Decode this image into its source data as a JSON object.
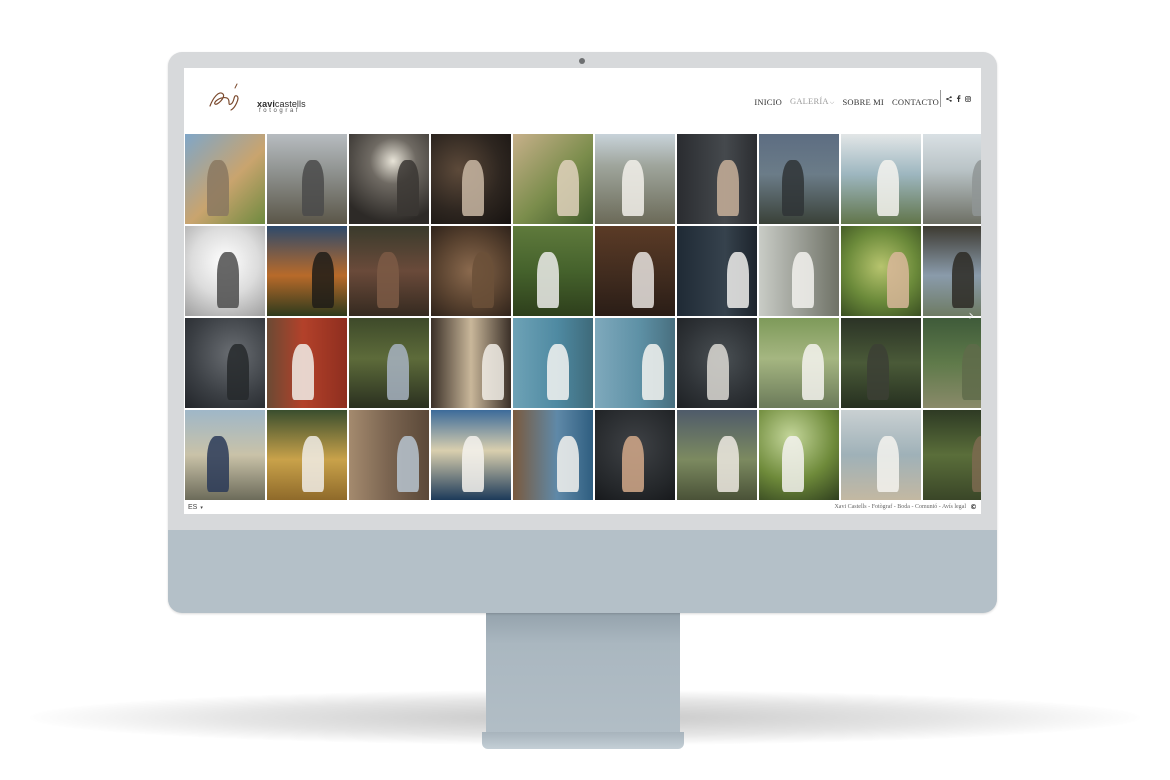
{
  "site": {
    "logo_word_bold": "xavi",
    "logo_word_light": "castells",
    "logo_sub": "fotograf"
  },
  "nav": {
    "items": [
      {
        "label": "INICIO"
      },
      {
        "label": "GALERÍA"
      },
      {
        "label": "SOBRE MI"
      },
      {
        "label": "CONTACTO"
      }
    ],
    "active": "GALERÍA"
  },
  "social_icons": [
    "share-icon",
    "facebook-icon",
    "instagram-icon"
  ],
  "gallery": {
    "rows": 4,
    "columns": 10,
    "next_arrow": "›",
    "tiles": [
      {
        "bg": "linear-gradient(135deg,#7fa6c8 0%,#c9a46e 55%,#6e8a3f 100%)",
        "fig": "#8a7860"
      },
      {
        "bg": "linear-gradient(180deg,#b7bcc0 0%,#8c8f8c 45%,#5b5648 100%)",
        "fig": "#4a4a4a"
      },
      {
        "bg": "radial-gradient(circle at 55% 30%,#e8e4d8 0%,#6f6a63 30%,#2d2a27 80%)",
        "fig": "#3a3632"
      },
      {
        "bg": "radial-gradient(circle at 35% 40%,#5d4a3a 0%,#2e2620 55%,#161210 100%)",
        "fig": "#c9b7a3"
      },
      {
        "bg": "linear-gradient(135deg,#c7b08a 0%,#7b8d4c 55%,#3f5a2a 100%)",
        "fig": "#e1d2bd"
      },
      {
        "bg": "linear-gradient(180deg,#c8d3da 0%,#9fa59c 35%,#6b6a58 100%)",
        "fig": "#f2f0ea"
      },
      {
        "bg": "linear-gradient(90deg,#2a2c30 0%,#45494d 60%,#2b2d31 100%)",
        "fig": "#c8b09a"
      },
      {
        "bg": "linear-gradient(180deg,#5d6d82 0%,#6b7c88 45%,#3a4138 100%)",
        "fig": "#2f3436"
      },
      {
        "bg": "linear-gradient(180deg,#e2e6e7 0%,#9db6bf 45%,#61754a 100%)",
        "fig": "#f4f3ee"
      },
      {
        "bg": "linear-gradient(180deg,#d9e0e4 0%,#b9c3c6 40%,#6d6f64 100%)",
        "fig": "#8f9595"
      },
      {
        "bg": "radial-gradient(circle at 50% 40%,#ffffff 0%,#dcdcdc 50%,#9e9e9e 100%)",
        "fig": "#4c4c4c"
      },
      {
        "bg": "linear-gradient(180deg,#2e4a6c 0%,#b86a2a 55%,#2e3a1c 100%)",
        "fig": "#1f1c18"
      },
      {
        "bg": "linear-gradient(180deg,#3a3b2c 0%,#6a4a3a 50%,#352a20 100%)",
        "fig": "#7c5a45"
      },
      {
        "bg": "radial-gradient(circle at 50% 50%,#8b6a4e 0%,#5a4330 55%,#2f231b 100%)",
        "fig": "#6b5038"
      },
      {
        "bg": "linear-gradient(180deg,#5f7a3c 0%,#45622c 50%,#2e3f1c 100%)",
        "fig": "#ececea"
      },
      {
        "bg": "linear-gradient(180deg,#5b3b26 0%,#3e2a1e 60%,#2a1d16 100%)",
        "fig": "#e7e3df"
      },
      {
        "bg": "linear-gradient(90deg,#1f2a35 0%,#36424d 60%,#1d242c 100%)",
        "fig": "#f0efec"
      },
      {
        "bg": "linear-gradient(90deg,#c9ccc6 0%,#9c9f97 50%,#6f7266 100%)",
        "fig": "#f3f2ee"
      },
      {
        "bg": "radial-gradient(circle at 50% 45%,#b7c46e 0%,#6b8a3a 55%,#3a4f22 100%)",
        "fig": "#d9b79a"
      },
      {
        "bg": "linear-gradient(180deg,#3d3a31 0%,#8a9bab 55%,#6e7b63 100%)",
        "fig": "#2d2a24"
      },
      {
        "bg": "radial-gradient(circle at 60% 40%,#6a6e73 0%,#3b3f44 60%,#22252a 100%)",
        "fig": "#26292c"
      },
      {
        "bg": "linear-gradient(90deg,#6b4a34 0%,#b3412a 45%,#8e2e1f 100%)",
        "fig": "#f1efe9"
      },
      {
        "bg": "linear-gradient(180deg,#3e4a2a 0%,#5d6b3a 45%,#2a3020 100%)",
        "fig": "#a7b3c2"
      },
      {
        "bg": "linear-gradient(90deg,#3b3028 0%,#c9b79a 50%,#3b3028 100%)",
        "fig": "#f2efe8"
      },
      {
        "bg": "linear-gradient(90deg,#6ea2b6 0%,#4f8aa2 55%,#3e6a7a 100%)",
        "fig": "#f5f5f2"
      },
      {
        "bg": "linear-gradient(90deg,#7fa9bc 0%,#5e91a6 55%,#486f7f 100%)",
        "fig": "#f4f4f1"
      },
      {
        "bg": "radial-gradient(circle at 55% 45%,#4a5054 0%,#2e3236 60%,#1e2124 100%)",
        "fig": "#dcd9d3"
      },
      {
        "bg": "linear-gradient(180deg,#7e9a5a 0%,#a5b681 45%,#6b7a5a 100%)",
        "fig": "#f4f3ef"
      },
      {
        "bg": "linear-gradient(180deg,#2b3326 0%,#4a5a38 50%,#263020 100%)",
        "fig": "#3c4035"
      },
      {
        "bg": "linear-gradient(180deg,#3f5b3a 0%,#5f7a4a 50%,#8a8a6a 100%)",
        "fig": "#5f6b4a"
      },
      {
        "bg": "linear-gradient(180deg,#9fb7c8 0%,#c9c2a8 50%,#6c6b5a 100%)",
        "fig": "#2a3a58"
      },
      {
        "bg": "linear-gradient(180deg,#3a4e2e 0%,#c9a24a 55%,#8f6a2a 100%)",
        "fig": "#f0ece6"
      },
      {
        "bg": "linear-gradient(90deg,#a48a6e 0%,#7a6450 50%,#5a4838 100%)",
        "fig": "#b7c4d0"
      },
      {
        "bg": "linear-gradient(180deg,#3c6b9a 0%,#d9cfae 45%,#1d3a5a 100%)",
        "fig": "#f4f2ed"
      },
      {
        "bg": "linear-gradient(90deg,#7a5a3e 0%,#5f89a8 55%,#2f5e80 100%)",
        "fig": "#f3f2ee"
      },
      {
        "bg": "radial-gradient(circle at 50% 40%,#3f4246 0%,#24272a 70%,#17191c 100%)",
        "fig": "#d4a98a"
      },
      {
        "bg": "linear-gradient(180deg,#4f5b6a 0%,#7c8a60 55%,#4a5238 100%)",
        "fig": "#ede9e2"
      },
      {
        "bg": "radial-gradient(circle at 40% 30%,#c4d69a 0%,#6e8a3a 55%,#2f3f1e 100%)",
        "fig": "#f3f2ee"
      },
      {
        "bg": "linear-gradient(180deg,#c9d0d2 0%,#9fb1b8 50%,#c3b8a2 100%)",
        "fig": "#f4f3ef"
      },
      {
        "bg": "linear-gradient(180deg,#2e3a24 0%,#5a6e3a 50%,#3a4628 100%)",
        "fig": "#7c6a50"
      }
    ]
  },
  "footer": {
    "lang": "ES",
    "lang_caret": "▾",
    "credits": "Xavi Castells - Fotògraf - Boda - Comunió - Avís legal",
    "copyright_icon": "copyright-icon"
  }
}
